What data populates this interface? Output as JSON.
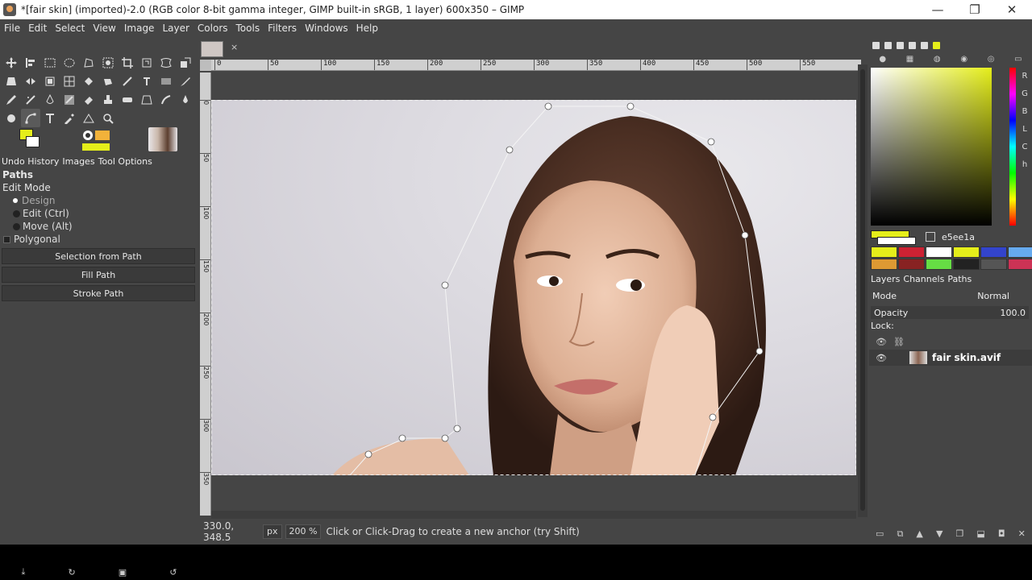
{
  "window": {
    "title": "*[fair skin] (imported)-2.0 (RGB color 8-bit gamma integer, GIMP built-in sRGB, 1 layer) 600x350 – GIMP",
    "minimize": "—",
    "maximize": "❐",
    "close": "✕"
  },
  "menu": [
    "File",
    "Edit",
    "Select",
    "View",
    "Image",
    "Layer",
    "Colors",
    "Tools",
    "Filters",
    "Windows",
    "Help"
  ],
  "colors": {
    "foreground": "#e5ee1a",
    "background": "#ffffff",
    "accent": "#e5ee1a"
  },
  "left_tabs": {
    "undo": "Undo History",
    "images": "Images",
    "tool_options": "Tool Options"
  },
  "tool_options": {
    "title": "Paths",
    "edit_mode": "Edit Mode",
    "modes": [
      "Design",
      "Edit (Ctrl)",
      "Move (Alt)"
    ],
    "polygonal": "Polygonal",
    "buttons": [
      "Selection from Path",
      "Fill Path",
      "Stroke Path"
    ]
  },
  "image_tab_close": "×",
  "ruler": {
    "h_ticks": [
      "0",
      "50",
      "100",
      "150",
      "200",
      "250",
      "300",
      "350",
      "400",
      "450",
      "500",
      "550"
    ],
    "v_ticks": [
      "0",
      "50",
      "100",
      "150",
      "200",
      "250",
      "300",
      "350"
    ]
  },
  "status": {
    "coords": "330.0, 348.5",
    "unit": "px",
    "zoom": "200 %",
    "message": "Click or Click-Drag to create a new anchor (try Shift)"
  },
  "color_panel": {
    "channels": [
      "R",
      "G",
      "B",
      "L",
      "C",
      "h"
    ],
    "hex": "e5ee1a",
    "swatches": [
      "#e5ee1a",
      "#cc2233",
      "#ffffff",
      "#e5ee1a",
      "#3344cc",
      "#66aaee",
      "#dd9933",
      "#882222",
      "#66dd44",
      "#222222",
      "#555555",
      "#cc3355"
    ]
  },
  "layers_panel": {
    "tabs": [
      "Layers",
      "Channels",
      "Paths"
    ],
    "mode_label": "Mode",
    "mode_value": "Normal",
    "opacity_label": "Opacity",
    "opacity_value": "100.0",
    "lock_label": "Lock:",
    "layer_name": "fair skin.avif"
  }
}
